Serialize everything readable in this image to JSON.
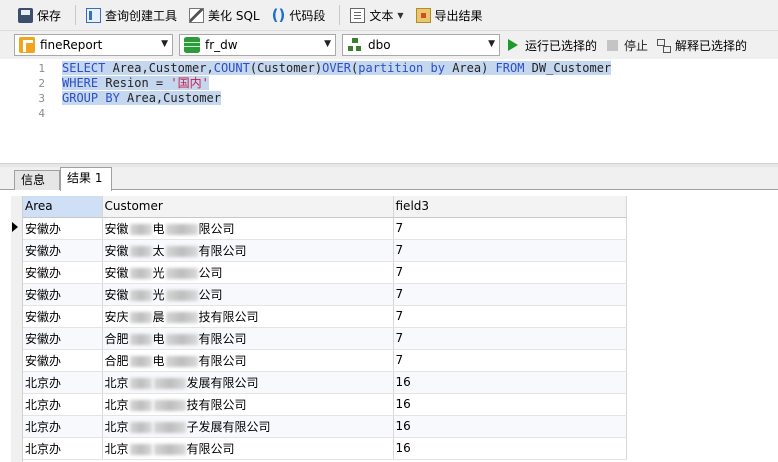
{
  "toolbar": {
    "save": "保存",
    "query_builder": "查询创建工具",
    "beautify": "美化 SQL",
    "code_snippet": "代码段",
    "text": "文本",
    "export": "导出结果"
  },
  "connection": {
    "connection_value": "fineReport",
    "database_value": "fr_dw",
    "schema_value": "dbo",
    "run_selected": "运行已选择的",
    "stop": "停止",
    "explain_selected": "解释已选择的"
  },
  "editor": {
    "line_numbers": [
      "1",
      "2",
      "3",
      "4"
    ],
    "lines": {
      "l1": {
        "kw_select": "SELECT",
        "cols": " Area,Customer,",
        "fn_count": "COUNT",
        "arg": "(Customer)",
        "kw_over": "OVER",
        "p_open": "(",
        "kw_partition": "partition",
        "sp1": " ",
        "kw_by": "by",
        "area": " Area) ",
        "kw_from": "FROM",
        "table": " DW_Customer"
      },
      "l2": {
        "kw_where": "WHERE",
        "cond": " Resion = ",
        "str": "'国内'"
      },
      "l3": {
        "kw_group": "GROUP BY",
        "cols": " Area,Customer"
      }
    }
  },
  "tabs": {
    "info": "信息",
    "result": "结果 1"
  },
  "grid": {
    "columns": [
      "Area",
      "Customer",
      "field3"
    ],
    "rows": [
      {
        "area": "安徽办",
        "cust_a": "安徽",
        "cust_b": "电",
        "cust_c": "限公司",
        "field3": "7"
      },
      {
        "area": "安徽办",
        "cust_a": "安徽",
        "cust_b": "太",
        "cust_c": "有限公司",
        "field3": "7"
      },
      {
        "area": "安徽办",
        "cust_a": "安徽",
        "cust_b": "光",
        "cust_c": "公司",
        "field3": "7"
      },
      {
        "area": "安徽办",
        "cust_a": "安徽",
        "cust_b": "光",
        "cust_c": "公司",
        "field3": "7"
      },
      {
        "area": "安徽办",
        "cust_a": "安庆",
        "cust_b": "晨",
        "cust_c": "技有限公司",
        "field3": "7"
      },
      {
        "area": "安徽办",
        "cust_a": "合肥",
        "cust_b": "电",
        "cust_c": "有限公司",
        "field3": "7"
      },
      {
        "area": "安徽办",
        "cust_a": "合肥",
        "cust_b": "电",
        "cust_c": "有限公司",
        "field3": "7"
      },
      {
        "area": "北京办",
        "cust_a": "北京",
        "cust_b": "",
        "cust_c": "发展有限公司",
        "field3": "16"
      },
      {
        "area": "北京办",
        "cust_a": "北京",
        "cust_b": "",
        "cust_c": "技有限公司",
        "field3": "16"
      },
      {
        "area": "北京办",
        "cust_a": "北京",
        "cust_b": "",
        "cust_c": "子发展有限公司",
        "field3": "16"
      },
      {
        "area": "北京办",
        "cust_a": "北京",
        "cust_b": "",
        "cust_c": "有限公司",
        "field3": "16"
      }
    ]
  }
}
